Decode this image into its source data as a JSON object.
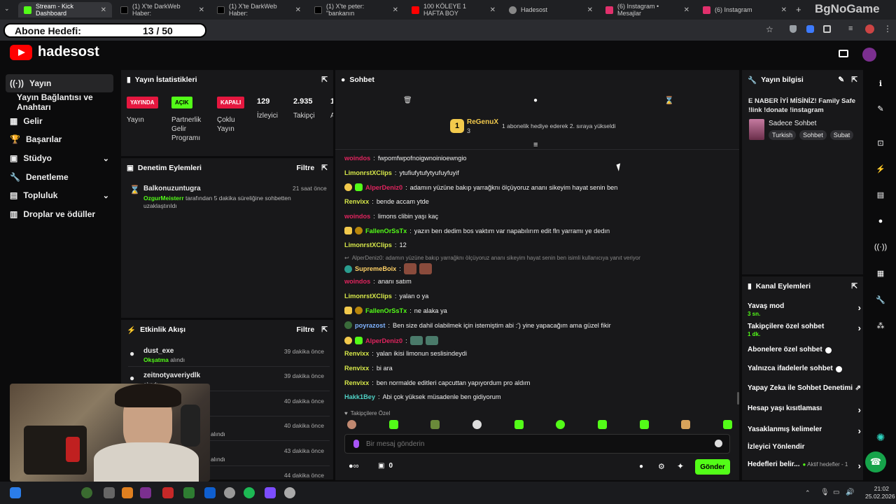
{
  "browser": {
    "tabs": [
      {
        "label": "Stream - Kick Dashboard",
        "color": "#53fc18",
        "active": true
      },
      {
        "label": "(1) X'te DarkWeb Haber:",
        "color": "#000000"
      },
      {
        "label": "(1) X'te DarkWeb Haber:",
        "color": "#000000"
      },
      {
        "label": "(1) X'te peter: \"bankanın",
        "color": "#000000"
      },
      {
        "label": "100 KÖLEYE 1 HAFTA BOY",
        "color": "#ff0000"
      },
      {
        "label": "Hadesost",
        "color": "#888888"
      },
      {
        "label": "(6) Instagram • Mesajlar",
        "color": "#e1306c"
      },
      {
        "label": "(6) Instagram",
        "color": "#e1306c"
      }
    ]
  },
  "overlay": {
    "goal_label": "Abone Hedefi:",
    "goal_count": "13 / 50",
    "watermark": "BgNoGame"
  },
  "header": {
    "channel_name": "hadesost"
  },
  "sidebar": {
    "items": [
      {
        "label": "Yayın",
        "icon": "broadcast-icon",
        "selected": true
      },
      {
        "label": "Yayın Bağlantısı ve Anahtarı"
      },
      {
        "label": "Gelir",
        "icon": "revenue-icon"
      },
      {
        "label": "Başarılar",
        "icon": "trophy-icon"
      },
      {
        "label": "Stüdyo",
        "icon": "studio-icon",
        "expand": true
      },
      {
        "label": "Denetleme",
        "icon": "wrench-icon"
      },
      {
        "label": "Topluluk",
        "icon": "community-icon",
        "expand": true
      },
      {
        "label": "Droplar ve ödüller",
        "icon": "gift-icon"
      }
    ]
  },
  "stats": {
    "title": "Yayın İstatistikleri",
    "yayin": {
      "badge": "YAYINDA",
      "label": "Yayın"
    },
    "partner": {
      "badge": "AÇIK",
      "label": "Partnerlik Gelir Programı"
    },
    "multi": {
      "badge": "KAPALI",
      "label": "Çoklu Yayın"
    },
    "viewers": {
      "value": "129",
      "label": "İzleyici"
    },
    "followers": {
      "value": "2.935",
      "label": "Takipçi"
    },
    "extra": {
      "value": "1",
      "label": "A"
    }
  },
  "moderation": {
    "title": "Denetim Eylemleri",
    "filter": "Filtre",
    "entry": {
      "user": "Balkonuzuntugra",
      "time": "21 saat önce",
      "mod": "OzgurMeisterr",
      "text": "tarafından 5 dakika süreliğine sohbetten uzaklaştırıldı"
    }
  },
  "activity": {
    "title": "Etkinlik Akışı",
    "filter": "Filtre",
    "items": [
      {
        "user": "dust_exe",
        "action": "Okşatma",
        "suffix": "alındı",
        "time": "39 dakika önce"
      },
      {
        "user": "zeitnotyaveriydlk",
        "action": "",
        "suffix": "alındı",
        "time": "39 dakika önce"
      },
      {
        "user": "",
        "action": "",
        "suffix": "",
        "time": "40 dakika önce"
      },
      {
        "user": "",
        "action": "",
        "suffix": "alındı",
        "time": "40 dakika önce"
      },
      {
        "user": "",
        "action": "",
        "suffix": "alındı",
        "time": "43 dakika önce"
      },
      {
        "user": "",
        "action": "",
        "suffix": "",
        "time": "44 dakika önce"
      }
    ]
  },
  "chat": {
    "title": "Sohbet",
    "pinned": {
      "user": "ReGenuX",
      "level": "3",
      "text": "1 abonelik hediye ederek 2. sıraya yükseldi"
    },
    "messages": [
      {
        "user": "woindos",
        "color": "#e0245e",
        "text": "fwpomfwpofnoigwnoinioewngio"
      },
      {
        "user": "LimonrstXClips",
        "color": "#d7e84a",
        "text": "ytufiufytufytyufuyfuyif"
      },
      {
        "user": "AlperDeniz0",
        "color": "#e0245e",
        "text": "adamın yüzüne bakıp yarrağknı ölçüyoruz ananı sikeyim hayat senin ben",
        "badges": 2
      },
      {
        "user": "Renvixx",
        "color": "#d7e84a",
        "text": "bende accam ytde"
      },
      {
        "user": "woindos",
        "color": "#e0245e",
        "text": "limons clibin yaşı kaç"
      },
      {
        "user": "FallenOrSsTx",
        "color": "#53fc18",
        "text": "yazın ben dedim bos vaktım var napabılırım edit fln yarramı ye dedın",
        "badges": 2
      },
      {
        "user": "LimonrstXClips",
        "color": "#d7e84a",
        "text": "12"
      },
      {
        "reply": "AlperDeniz0: adamın yüzüne bakıp yarrağknı ölçüyoruz ananı sikeyim hayat senin ben isimli kullanıcıya yanıt veriyor"
      },
      {
        "user": "SupremeBoix",
        "color": "#ffd166",
        "text": "",
        "emotes": 2
      },
      {
        "user": "woindos",
        "color": "#e0245e",
        "text": "ananı satım"
      },
      {
        "user": "LimonrstXClips",
        "color": "#d7e84a",
        "text": "yalan o ya"
      },
      {
        "user": "FallenOrSsTx",
        "color": "#53fc18",
        "text": "ne alaka ya",
        "badges": 2
      },
      {
        "user": "poyrazost",
        "color": "#7fb3ff",
        "text": "Ben size dahil olabilmek için istemiştim abi :') yine yapacağım ama güzel fikir",
        "badges": 1
      },
      {
        "user": "AlperDeniz0",
        "color": "#e0245e",
        "text": "",
        "badges": 2,
        "emotes": 2
      },
      {
        "user": "Renvixx",
        "color": "#d7e84a",
        "text": "yalan ikisi limonun seslisindeydi"
      },
      {
        "user": "Renvixx",
        "color": "#d7e84a",
        "text": "bi ara"
      },
      {
        "user": "Renvixx",
        "color": "#d7e84a",
        "text": "ben normalde editleri capcuttan yapıyordum pro aldım"
      },
      {
        "user": "Hakk1Bey",
        "color": "#4fd1c5",
        "text": "Abi çok yüksek müsadenle ben gidiyorum"
      }
    ],
    "followers_only": "Takipçilere Özel",
    "input_placeholder": "Bir mesaj gönderin",
    "points": "0",
    "send": "Gönder"
  },
  "stream_info": {
    "title": "Yayın bilgisi",
    "stream_title": "E NABER İYİ MİSİNİZ! Family Safe !link !donate !instagram",
    "category": "Sadece Sohbet",
    "tags": [
      "Turkish",
      "Sohbet",
      "Subat"
    ]
  },
  "channel_actions": {
    "title": "Kanal Eylemleri",
    "items": [
      {
        "label": "Yavaş mod",
        "sub": "3 sn.",
        "type": "arrow"
      },
      {
        "label": "Takipçilere özel sohbet",
        "sub": "1 dk.",
        "type": "arrow"
      },
      {
        "label": "Abonelere özel sohbet",
        "type": "toggle"
      },
      {
        "label": "Yalnızca ifadelerle sohbet",
        "type": "toggle"
      },
      {
        "label": "Yapay Zeka ile Sohbet Denetimi",
        "type": "external"
      },
      {
        "label": "Hesap yaşı kısıtlaması",
        "type": "arrow"
      },
      {
        "label": "Yasaklanmış kelimeler",
        "type": "arrow"
      },
      {
        "label": "İzleyici Yönlendir",
        "type": "none"
      },
      {
        "label": "Hedefleri belir...",
        "sub_inline": "Aktif hedefler - 1",
        "type": "arrow"
      }
    ]
  },
  "taskbar": {
    "time": "21:02",
    "date": "25.02.2026"
  }
}
